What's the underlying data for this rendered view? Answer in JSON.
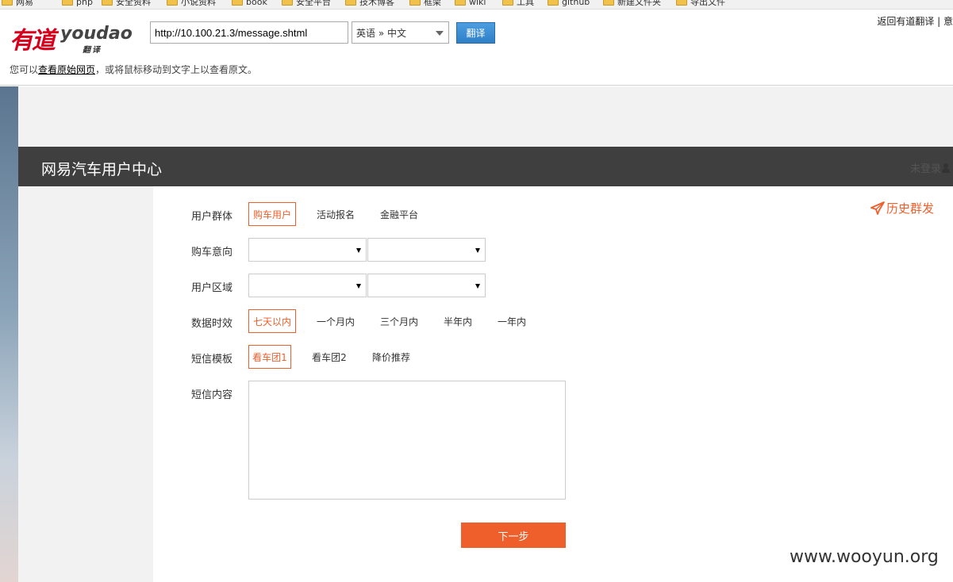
{
  "bookmarks": [
    {
      "label": "网易"
    },
    {
      "label": "php"
    },
    {
      "label": "安全资料"
    },
    {
      "label": "小说资料"
    },
    {
      "label": "book"
    },
    {
      "label": "安全平台"
    },
    {
      "label": "技术博客"
    },
    {
      "label": "框架"
    },
    {
      "label": "wiki"
    },
    {
      "label": "工具"
    },
    {
      "label": "github"
    },
    {
      "label": "新建文件夹"
    },
    {
      "label": "导出文件"
    }
  ],
  "youdao": {
    "url_value": "http://10.100.21.3/message.shtml",
    "lang_pair": "英语 » 中文",
    "translate_label": "翻译",
    "back_link": "返回有道翻译 | 意",
    "hint_prefix": "您可以",
    "hint_link": "查看原始网页",
    "hint_suffix": "，或将鼠标移动到文字上以查看原文。"
  },
  "site": {
    "title": "网易汽车用户中心",
    "login_status": "未登录"
  },
  "history_label": "历史群发",
  "form": {
    "user_group": {
      "label": "用户群体",
      "options": [
        "购车用户",
        "活动报名",
        "金融平台"
      ],
      "selected": "购车用户"
    },
    "purchase_intent": {
      "label": "购车意向"
    },
    "user_region": {
      "label": "用户区域"
    },
    "data_period": {
      "label": "数据时效",
      "options": [
        "七天以内",
        "一个月内",
        "三个月内",
        "半年内",
        "一年内"
      ],
      "selected": "七天以内"
    },
    "sms_template": {
      "label": "短信模板",
      "options": [
        "看车团1",
        "看车团2",
        "降价推荐"
      ],
      "selected": "看车团1"
    },
    "sms_content": {
      "label": "短信内容",
      "value": ""
    },
    "next_label": "下一步"
  },
  "watermark": "www.wooyun.org",
  "colors": {
    "accent": "#ee5f2c",
    "header_bar": "#3f3f3f",
    "youdao_red": "#d6001c",
    "translate_button": "#2f7fc8"
  }
}
